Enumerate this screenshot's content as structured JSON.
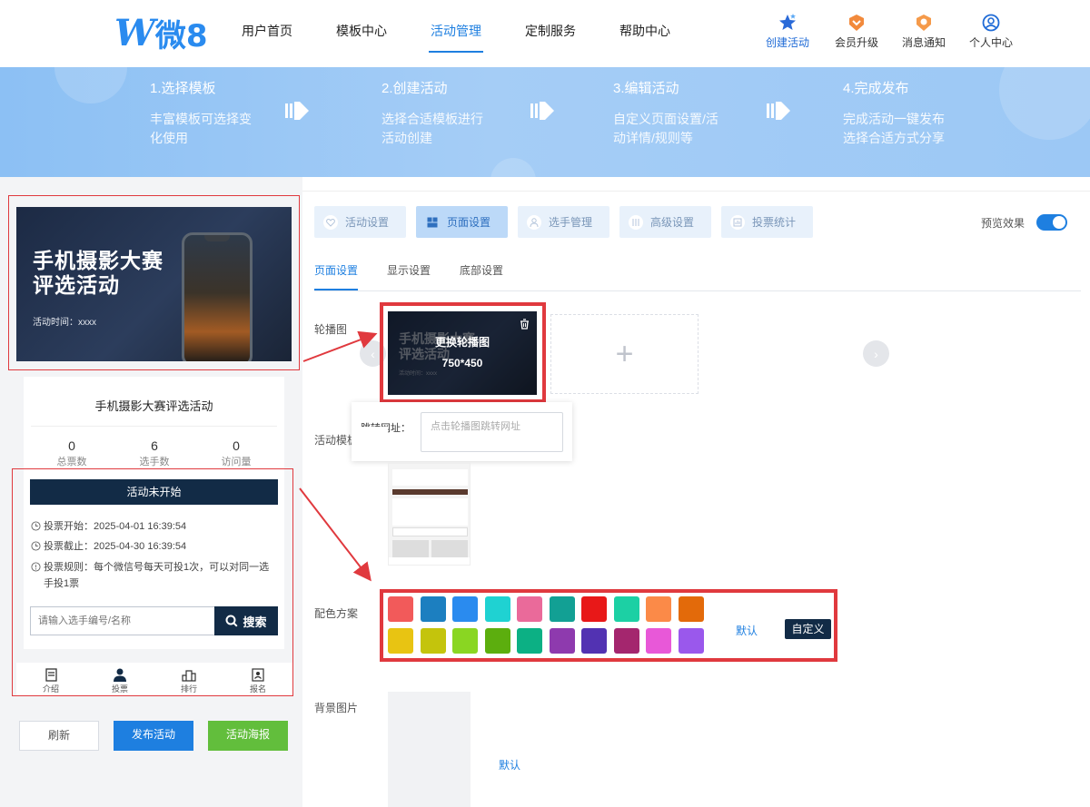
{
  "header": {
    "logo_letter": "W",
    "logo_text": "微8",
    "nav": [
      {
        "label": "用户首页"
      },
      {
        "label": "模板中心"
      },
      {
        "label": "活动管理",
        "active": true
      },
      {
        "label": "定制服务"
      },
      {
        "label": "帮助中心"
      }
    ],
    "actions": [
      {
        "label": "创建活动",
        "icon": "star-icon"
      },
      {
        "label": "会员升级",
        "icon": "vip-badge-icon"
      },
      {
        "label": "消息通知",
        "icon": "bell-badge-icon"
      },
      {
        "label": "个人中心",
        "icon": "user-circle-icon"
      }
    ]
  },
  "banner": {
    "steps": [
      {
        "title": "1.选择模板",
        "desc": "丰富模板可选择变化使用"
      },
      {
        "title": "2.创建活动",
        "desc": "选择合适模板进行活动创建"
      },
      {
        "title": "3.编辑活动",
        "desc": "自定义页面设置/活动详情/规则等"
      },
      {
        "title": "4.完成发布",
        "desc": "完成活动一键发布选择合适方式分享"
      }
    ]
  },
  "preview": {
    "banner_title_line1": "手机摄影大赛",
    "banner_title_line2": "评选活动",
    "banner_time": "活动时间：xxxx",
    "activity_name": "手机摄影大赛评选活动",
    "stats": [
      {
        "value": "0",
        "label": "总票数"
      },
      {
        "value": "6",
        "label": "选手数"
      },
      {
        "value": "0",
        "label": "访问量"
      }
    ],
    "status": "活动未开始",
    "vote_start": "投票开始：2025-04-01 16:39:54",
    "vote_end": "投票截止：2025-04-30 16:39:54",
    "vote_rule": "投票规则：每个微信号每天可投1次，可以对同一选手投1票",
    "search_placeholder": "请输入选手编号/名称",
    "search_button": "搜索",
    "bottom_tabs": [
      {
        "label": "介绍",
        "icon": "doc-icon"
      },
      {
        "label": "投票",
        "icon": "person-icon"
      },
      {
        "label": "排行",
        "icon": "ranking-icon"
      },
      {
        "label": "报名",
        "icon": "id-card-icon"
      }
    ],
    "buttons": {
      "refresh": "刷新",
      "publish": "发布活动",
      "poster": "活动海报"
    }
  },
  "settings": {
    "main_tabs": [
      {
        "label": "活动设置",
        "icon": "heart-icon"
      },
      {
        "label": "页面设置",
        "icon": "grid-icon",
        "active": true
      },
      {
        "label": "选手管理",
        "icon": "user-icon"
      },
      {
        "label": "高级设置",
        "icon": "sliders-icon"
      },
      {
        "label": "投票统计",
        "icon": "chart-icon"
      }
    ],
    "preview_label": "预览效果",
    "preview_on": true,
    "sub_tabs": [
      {
        "label": "页面设置",
        "active": true
      },
      {
        "label": "显示设置"
      },
      {
        "label": "底部设置"
      }
    ],
    "carousel_label": "轮播图",
    "carousel_replace": "更换轮播图",
    "carousel_size": "750*450",
    "carousel_thumb_line1": "手机摄影大赛",
    "carousel_thumb_line2": "评选活动",
    "carousel_thumb_time": "活动时间：xxxx",
    "popup_label": "跳转网址：",
    "popup_placeholder": "点击轮播图跳转网址",
    "template_label": "活动模板",
    "color_label": "配色方案",
    "colors_row1": [
      "#f25a5a",
      "#1c7fc0",
      "#2a8bef",
      "#1fd2d2",
      "#ea6a9a",
      "#12a094",
      "#e81818",
      "#1cd0a4",
      "#fb8a48",
      "#e36a0a"
    ],
    "colors_row2": [
      "#e8c412",
      "#c4c40c",
      "#8ad622",
      "#5cae0e",
      "#0cb084",
      "#8e3aae",
      "#5232b2",
      "#a4266e",
      "#e858d8",
      "#9a58ec"
    ],
    "color_default": "默认",
    "color_custom": "自定义",
    "bg_label": "背景图片",
    "bg_default": "默认"
  }
}
